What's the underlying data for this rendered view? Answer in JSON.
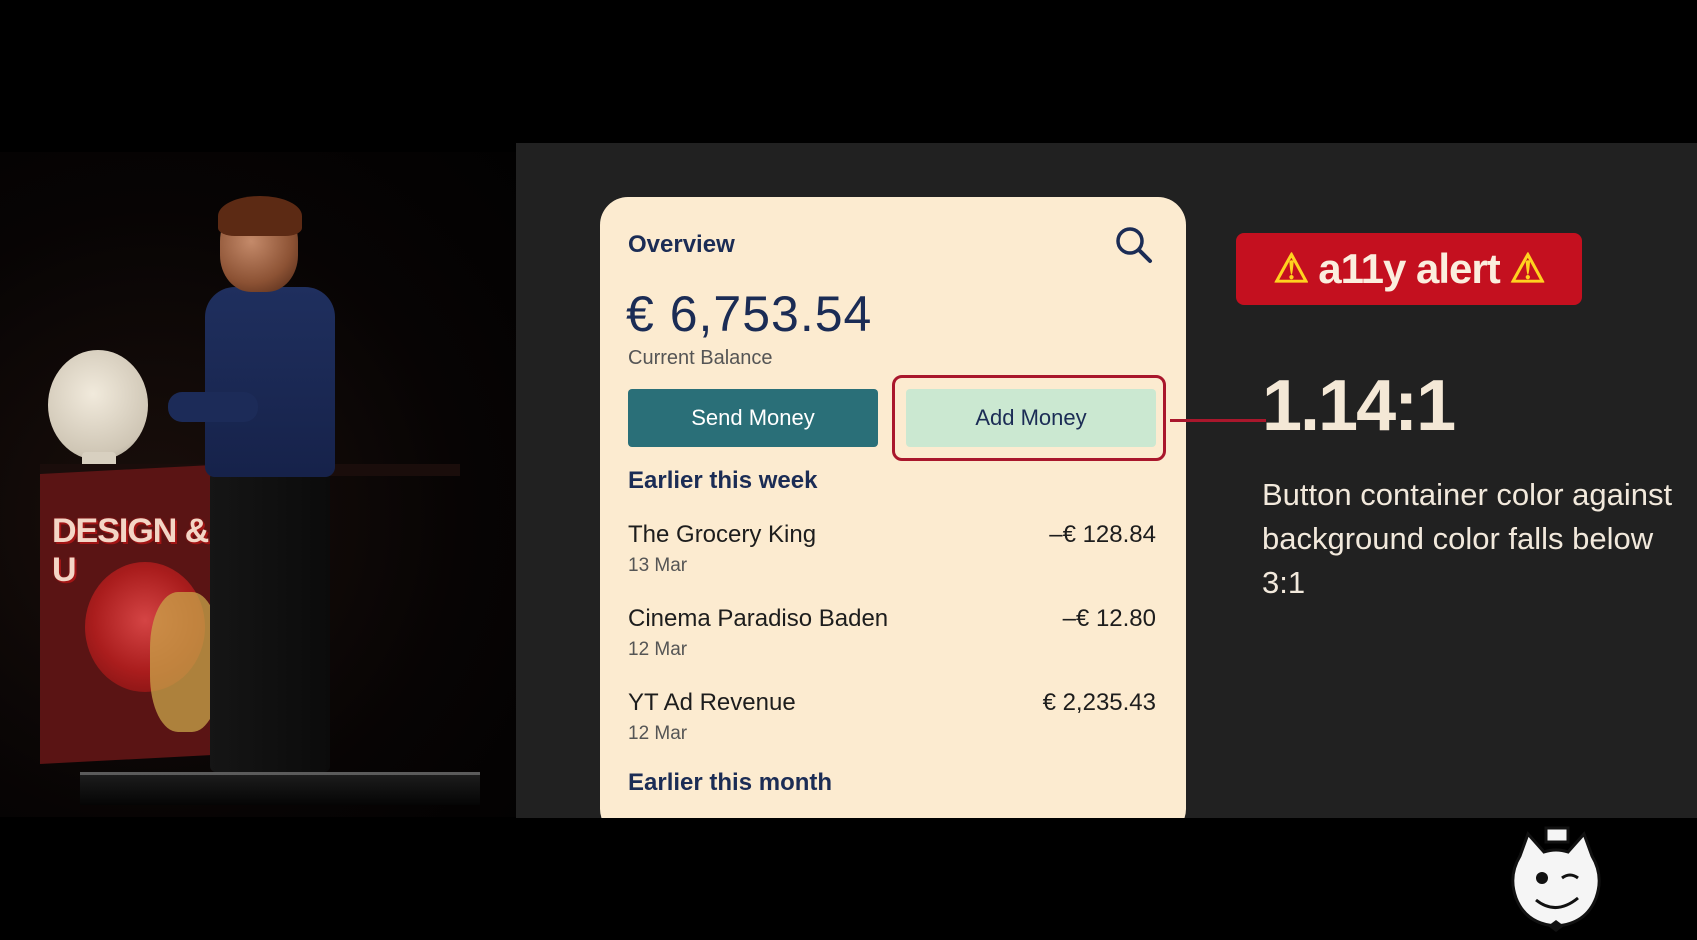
{
  "colors": {
    "slide_background": "#212121",
    "card_background": "#fcebd0",
    "send_button": "#2a6f78",
    "add_button": "#cbe8d1",
    "alert_red": "#c4101f",
    "heading_navy": "#1b2c55"
  },
  "stage": {
    "podium_banner": "DESIGN & U"
  },
  "app": {
    "title": "Overview",
    "search_icon": "search-icon",
    "balance": "€ 6,753.54",
    "balance_label": "Current Balance",
    "send_button": "Send Money",
    "add_button": "Add Money",
    "sections": [
      {
        "title": "Earlier this week",
        "transactions": [
          {
            "name": "The Grocery King",
            "date": "13 Mar",
            "amount": "–€ 128.84"
          },
          {
            "name": "Cinema Paradiso Baden",
            "date": "12 Mar",
            "amount": "–€ 12.80"
          },
          {
            "name": "YT Ad Revenue",
            "date": "12 Mar",
            "amount": "€ 2,235.43"
          }
        ]
      },
      {
        "title": "Earlier this month",
        "transactions": []
      }
    ]
  },
  "annotation": {
    "alert_label": "a11y alert",
    "warning_icon": "warning-icon",
    "ratio": "1.14:1",
    "description": "Button container color against background color falls below 3:1"
  }
}
